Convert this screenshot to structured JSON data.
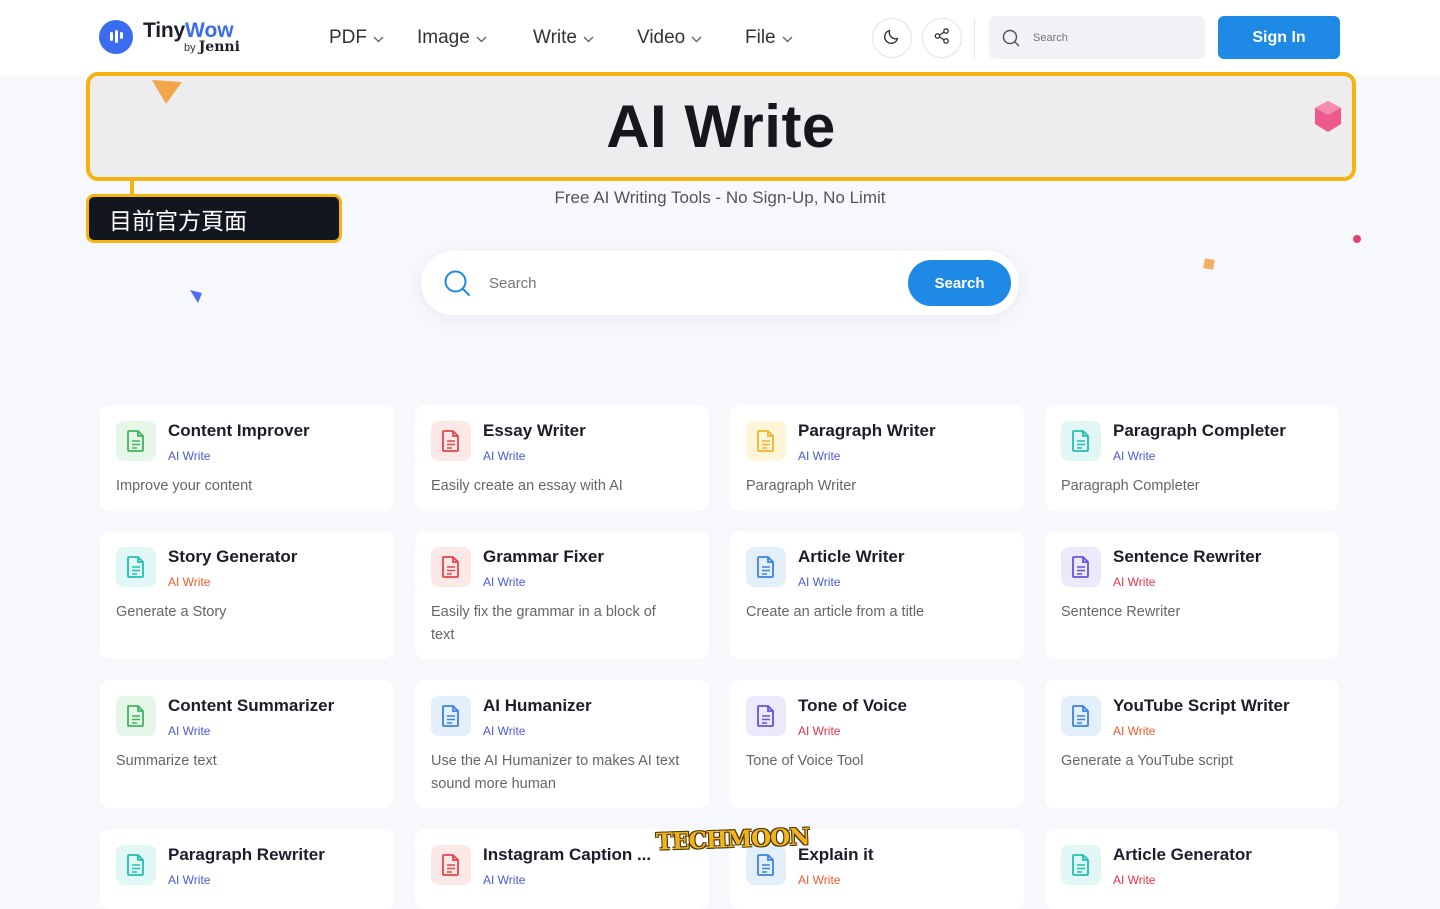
{
  "header": {
    "logo": {
      "brand_a": "Tiny",
      "brand_b": "Wow",
      "by": "by",
      "by_name": "Jenni"
    },
    "nav": [
      {
        "label": "PDF"
      },
      {
        "label": "Image"
      },
      {
        "label": "Write"
      },
      {
        "label": "Video"
      },
      {
        "label": "File"
      }
    ],
    "search_placeholder": "Search",
    "signin_label": "Sign In",
    "icons": [
      "moon-icon",
      "share-icon",
      "search-icon"
    ]
  },
  "hero": {
    "title": "AI Write",
    "badge": "目前官方頁面",
    "subtitle": "Free AI Writing Tools - No Sign-Up, No Limit",
    "search_placeholder": "Search",
    "search_button": "Search"
  },
  "colors": {
    "accent": "#1f8ae5",
    "highlight": "#f5b210",
    "category_blue": "#4a5bd4",
    "category_orange": "#ef5b2a",
    "category_red": "#e0334a"
  },
  "tools": [
    {
      "title": "Content Improver",
      "category": "AI Write",
      "description": "Improve your content",
      "icon_color": "green",
      "category_color": "blue"
    },
    {
      "title": "Essay Writer",
      "category": "AI Write",
      "description": "Easily create an essay with AI",
      "icon_color": "red",
      "category_color": "blue"
    },
    {
      "title": "Paragraph Writer",
      "category": "AI Write",
      "description": "Paragraph Writer",
      "icon_color": "yellow",
      "category_color": "blue"
    },
    {
      "title": "Paragraph Completer",
      "category": "AI Write",
      "description": "Paragraph Completer",
      "icon_color": "teal",
      "category_color": "blue"
    },
    {
      "title": "Story Generator",
      "category": "AI Write",
      "description": "Generate a Story",
      "icon_color": "teal",
      "category_color": "orange"
    },
    {
      "title": "Grammar Fixer",
      "category": "AI Write",
      "description": "Easily fix the grammar in a block of text",
      "icon_color": "red",
      "category_color": "blue"
    },
    {
      "title": "Article Writer",
      "category": "AI Write",
      "description": "Create an article from a title",
      "icon_color": "blue",
      "category_color": "blue"
    },
    {
      "title": "Sentence Rewriter",
      "category": "AI Write",
      "description": "Sentence Rewriter",
      "icon_color": "purple",
      "category_color": "red"
    },
    {
      "title": "Content Summarizer",
      "category": "AI Write",
      "description": "Summarize text",
      "icon_color": "green",
      "category_color": "blue"
    },
    {
      "title": "AI Humanizer",
      "category": "AI Write",
      "description": "Use the AI Humanizer to makes AI text sound more human",
      "icon_color": "blue",
      "category_color": "blue"
    },
    {
      "title": "Tone of Voice",
      "category": "AI Write",
      "description": "Tone of Voice Tool",
      "icon_color": "purple",
      "category_color": "red"
    },
    {
      "title": "YouTube Script Writer",
      "category": "AI Write",
      "description": "Generate a YouTube script",
      "icon_color": "blue",
      "category_color": "orange"
    },
    {
      "title": "Paragraph Rewriter",
      "category": "AI Write",
      "description": "",
      "icon_color": "teal",
      "category_color": "blue"
    },
    {
      "title": "Instagram Caption ...",
      "category": "AI Write",
      "description": "",
      "icon_color": "red",
      "category_color": "blue"
    },
    {
      "title": "Explain it",
      "category": "AI Write",
      "description": "",
      "icon_color": "blue",
      "category_color": "orange"
    },
    {
      "title": "Article Generator",
      "category": "AI Write",
      "description": "",
      "icon_color": "teal",
      "category_color": "red"
    }
  ],
  "watermark": "TECHMOON"
}
